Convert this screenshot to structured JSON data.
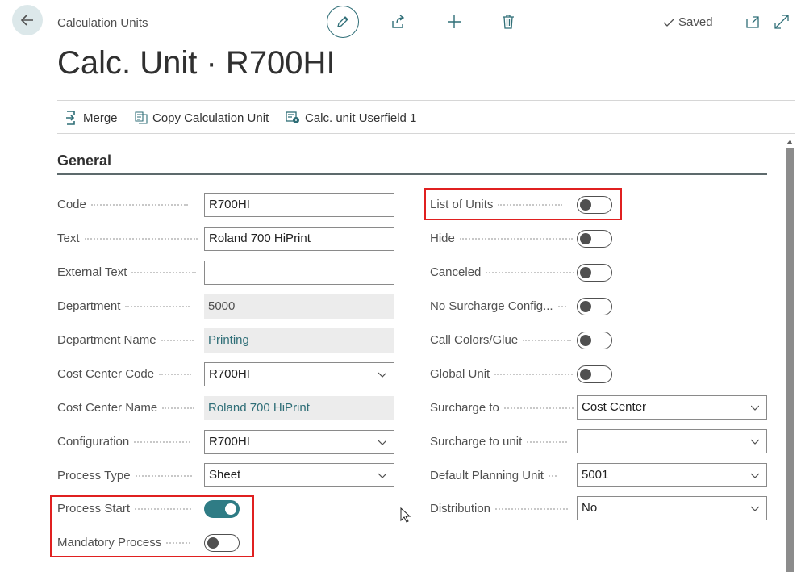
{
  "header": {
    "breadcrumb": "Calculation Units",
    "title": "Calc. Unit · R700HI",
    "saved_label": "Saved",
    "icons": [
      "back-arrow-icon",
      "pencil-icon",
      "share-icon",
      "plus-icon",
      "trash-icon",
      "checkmark-icon",
      "open-new-window-icon",
      "expand-icon"
    ]
  },
  "actions": [
    {
      "label": "Merge",
      "icon": "merge-icon"
    },
    {
      "label": "Copy Calculation Unit",
      "icon": "copy-icon"
    },
    {
      "label": "Calc. unit Userfield 1",
      "icon": "userfield-icon"
    }
  ],
  "section": {
    "title": "General"
  },
  "left_fields": [
    {
      "label": "Code",
      "value": "R700HI",
      "kind": "input"
    },
    {
      "label": "Text",
      "value": "Roland 700 HiPrint",
      "kind": "input"
    },
    {
      "label": "External Text",
      "value": "",
      "kind": "input"
    },
    {
      "label": "Department",
      "value": "5000",
      "kind": "readonly"
    },
    {
      "label": "Department Name",
      "value": "Printing",
      "kind": "readonly-link"
    },
    {
      "label": "Cost Center Code",
      "value": "R700HI",
      "kind": "select"
    },
    {
      "label": "Cost Center Name",
      "value": "Roland 700 HiPrint",
      "kind": "readonly-link"
    },
    {
      "label": "Configuration",
      "value": "R700HI",
      "kind": "select"
    },
    {
      "label": "Process Type",
      "value": "Sheet",
      "kind": "select"
    },
    {
      "label": "Process Start",
      "value": true,
      "kind": "toggle"
    },
    {
      "label": "Mandatory Process",
      "value": false,
      "kind": "toggle"
    }
  ],
  "right_fields": [
    {
      "label": "List of Units",
      "value": false,
      "kind": "toggle"
    },
    {
      "label": "Hide",
      "value": false,
      "kind": "toggle"
    },
    {
      "label": "Canceled",
      "value": false,
      "kind": "toggle"
    },
    {
      "label": "No Surcharge Config...",
      "value": false,
      "kind": "toggle"
    },
    {
      "label": "Call Colors/Glue",
      "value": false,
      "kind": "toggle"
    },
    {
      "label": "Global Unit",
      "value": false,
      "kind": "toggle"
    },
    {
      "label": "Surcharge to",
      "value": "Cost Center",
      "kind": "select"
    },
    {
      "label": "Surcharge to unit",
      "value": "",
      "kind": "select"
    },
    {
      "label": "Default Planning Unit",
      "value": "5001",
      "kind": "select"
    },
    {
      "label": "Distribution",
      "value": "No",
      "kind": "select"
    }
  ],
  "colors": {
    "accent": "#2f7c85",
    "highlight": "#e02020",
    "readonly_bg": "#ececec"
  }
}
